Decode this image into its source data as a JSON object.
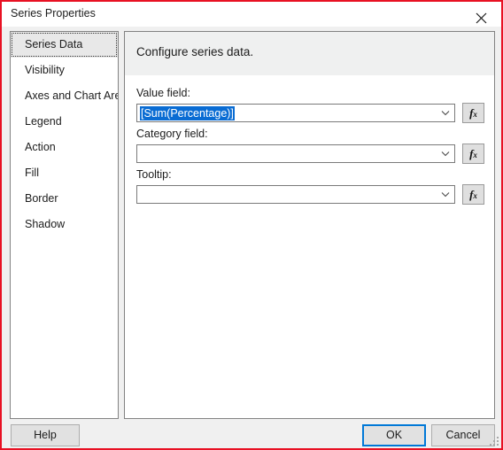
{
  "window": {
    "title": "Series Properties",
    "close_icon": "close-icon"
  },
  "sidebar": {
    "items": [
      {
        "label": "Series Data",
        "selected": true
      },
      {
        "label": "Visibility",
        "selected": false
      },
      {
        "label": "Axes and Chart Area",
        "selected": false
      },
      {
        "label": "Legend",
        "selected": false
      },
      {
        "label": "Action",
        "selected": false
      },
      {
        "label": "Fill",
        "selected": false
      },
      {
        "label": "Border",
        "selected": false
      },
      {
        "label": "Shadow",
        "selected": false
      }
    ]
  },
  "content": {
    "heading": "Configure series data.",
    "fields": [
      {
        "label": "Value field:",
        "value": "[Sum(Percentage)]",
        "placeholder": "",
        "selected": true,
        "expression_button": "fx"
      },
      {
        "label": "Category field:",
        "value": "",
        "placeholder": "",
        "selected": false,
        "expression_button": "fx"
      },
      {
        "label": "Tooltip:",
        "value": "",
        "placeholder": "",
        "selected": false,
        "expression_button": "fx"
      }
    ]
  },
  "footer": {
    "help_label": "Help",
    "ok_label": "OK",
    "cancel_label": "Cancel"
  },
  "colors": {
    "window_border": "#e81123",
    "accent_focus": "#0078d7",
    "text_selection": "#0a6cd3",
    "panel_header": "#eff0f0",
    "dialog_background": "#f0f0f0"
  }
}
